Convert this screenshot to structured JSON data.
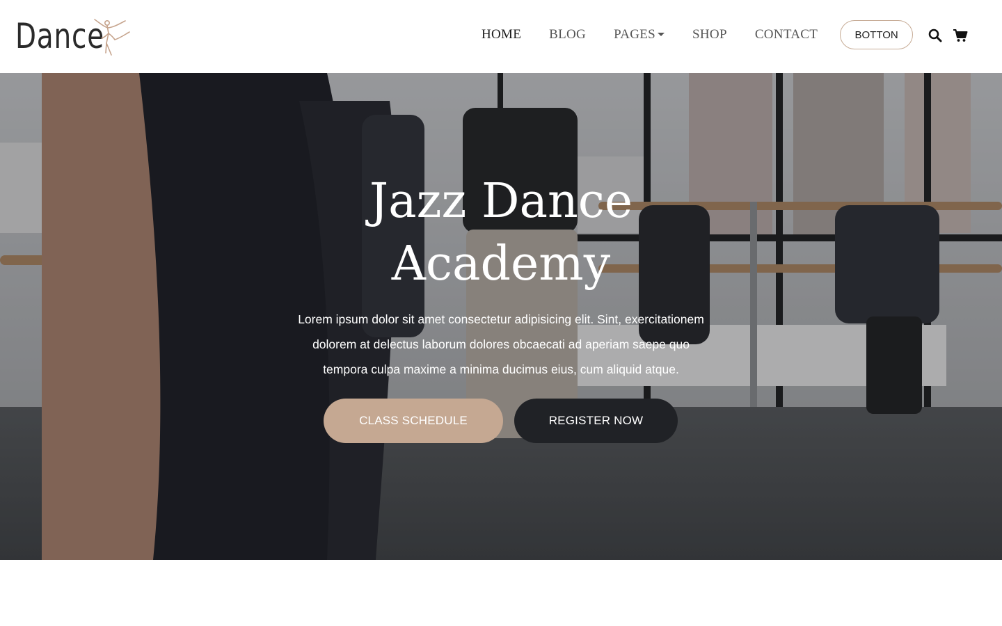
{
  "brand": {
    "logo_text": "Dance",
    "logo_icon": "ballerina-icon",
    "accent_color": "#c5a892"
  },
  "nav": {
    "items": [
      {
        "label": "HOME",
        "active": true
      },
      {
        "label": "BLOG",
        "active": false
      },
      {
        "label": "PAGES",
        "active": false,
        "dropdown": true
      },
      {
        "label": "SHOP",
        "active": false
      },
      {
        "label": "CONTACT",
        "active": false
      }
    ],
    "button_label": "BOTTON",
    "icons": [
      "search-icon",
      "cart-icon"
    ]
  },
  "hero": {
    "title_line1": "Jazz Dance",
    "title_line2": "Academy",
    "description_line1": "Lorem ipsum dolor sit amet consectetur adipisicing elit. Sint, exercitationem",
    "description_line2": "dolorem at delectus laborum dolores obcaecati ad aperiam saepe quo",
    "description_line3": "tempora culpa maxime a minima ducimus eius, cum aliquid atque.",
    "primary_button": "CLASS SCHEDULE",
    "secondary_button": "REGISTER NOW",
    "primary_color": "#c5a892",
    "secondary_color": "#202226"
  }
}
